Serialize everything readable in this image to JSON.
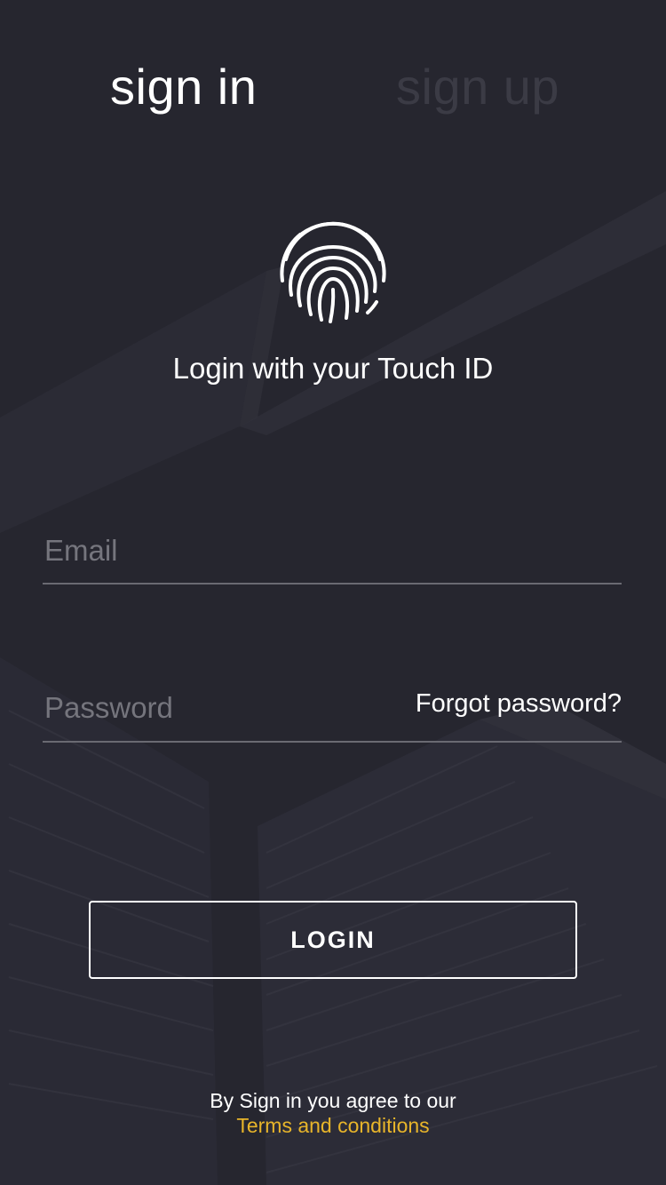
{
  "tabs": {
    "sign_in": "sign in",
    "sign_up": "sign up"
  },
  "touch_id": {
    "icon": "fingerprint-icon",
    "label": "Login with your Touch ID"
  },
  "form": {
    "email_placeholder": "Email",
    "email_value": "",
    "password_placeholder": "Password",
    "password_value": "",
    "forgot_password": "Forgot password?"
  },
  "actions": {
    "login_label": "LOGIN"
  },
  "footer": {
    "agree_text": "By Sign in you agree to our",
    "terms_link": "Terms and conditions"
  },
  "colors": {
    "background": "#26262f",
    "active_tab": "#ffffff",
    "inactive_tab": "#3b3b45",
    "link_accent": "#e8b52a"
  }
}
